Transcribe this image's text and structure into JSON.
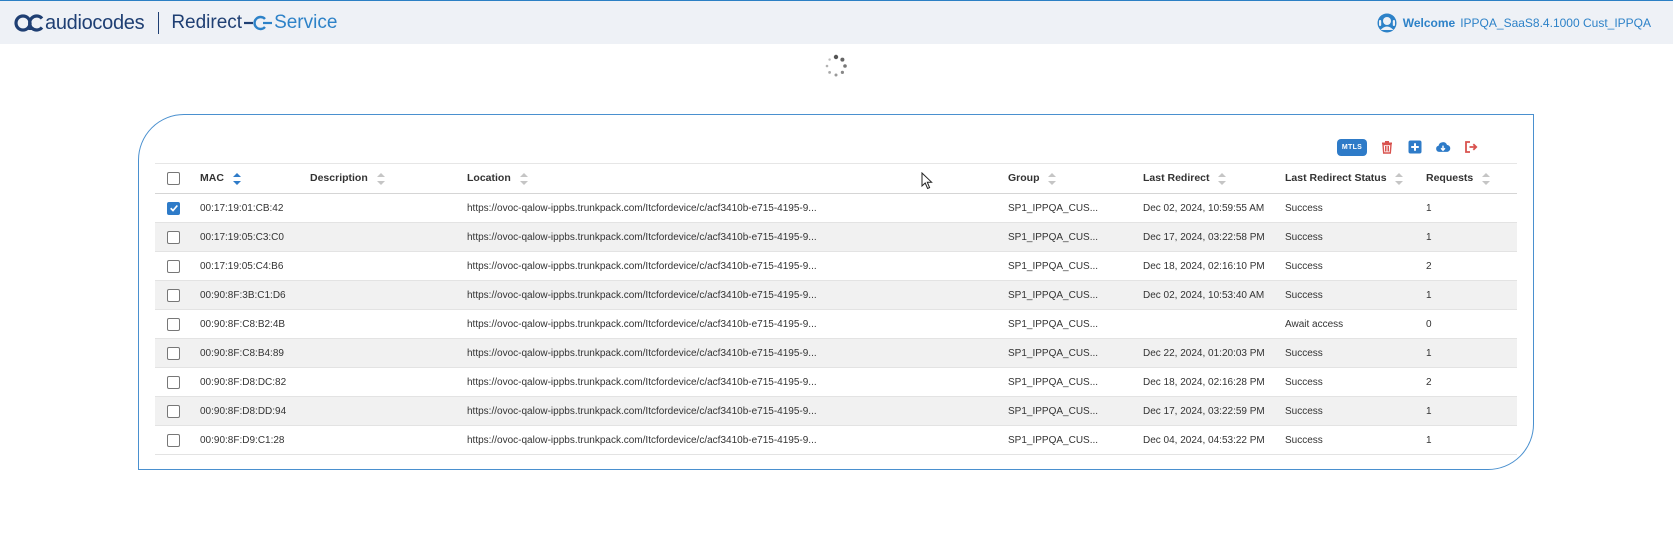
{
  "header": {
    "brand": "audiocodes",
    "service_name_part1": "Redirect",
    "service_name_part2": "Service",
    "welcome_label": "Welcome",
    "welcome_user": "IPPQA_SaaS8.4.1000 Cust_IPPQA"
  },
  "toolbar": {
    "mtls_label": "MTLS",
    "icons": [
      "trash-icon",
      "add-icon",
      "cloud-download-icon",
      "logout-icon"
    ]
  },
  "table": {
    "columns": [
      "MAC",
      "Description",
      "Location",
      "Group",
      "Last Redirect",
      "Last Redirect Status",
      "Requests"
    ],
    "sorted_column": "MAC",
    "rows": [
      {
        "checked": true,
        "mac": "00:17:19:01:CB:42",
        "description": "",
        "location": "https://ovoc-qalow-ippbs.trunkpack.com/Itcfordevice/c/acf3410b-e715-4195-9...",
        "group": "SP1_IPPQA_CUS...",
        "last_redirect": "Dec 02, 2024, 10:59:55 AM",
        "status": "Success",
        "requests": "1"
      },
      {
        "checked": false,
        "mac": "00:17:19:05:C3:C0",
        "description": "",
        "location": "https://ovoc-qalow-ippbs.trunkpack.com/Itcfordevice/c/acf3410b-e715-4195-9...",
        "group": "SP1_IPPQA_CUS...",
        "last_redirect": "Dec 17, 2024, 03:22:58 PM",
        "status": "Success",
        "requests": "1"
      },
      {
        "checked": false,
        "mac": "00:17:19:05:C4:B6",
        "description": "",
        "location": "https://ovoc-qalow-ippbs.trunkpack.com/Itcfordevice/c/acf3410b-e715-4195-9...",
        "group": "SP1_IPPQA_CUS...",
        "last_redirect": "Dec 18, 2024, 02:16:10 PM",
        "status": "Success",
        "requests": "2"
      },
      {
        "checked": false,
        "mac": "00:90:8F:3B:C1:D6",
        "description": "",
        "location": "https://ovoc-qalow-ippbs.trunkpack.com/Itcfordevice/c/acf3410b-e715-4195-9...",
        "group": "SP1_IPPQA_CUS...",
        "last_redirect": "Dec 02, 2024, 10:53:40 AM",
        "status": "Success",
        "requests": "1"
      },
      {
        "checked": false,
        "mac": "00:90:8F:C8:B2:4B",
        "description": "",
        "location": "https://ovoc-qalow-ippbs.trunkpack.com/Itcfordevice/c/acf3410b-e715-4195-9...",
        "group": "SP1_IPPQA_CUS...",
        "last_redirect": "",
        "status": "Await access",
        "requests": "0"
      },
      {
        "checked": false,
        "mac": "00:90:8F:C8:B4:89",
        "description": "",
        "location": "https://ovoc-qalow-ippbs.trunkpack.com/Itcfordevice/c/acf3410b-e715-4195-9...",
        "group": "SP1_IPPQA_CUS...",
        "last_redirect": "Dec 22, 2024, 01:20:03 PM",
        "status": "Success",
        "requests": "1"
      },
      {
        "checked": false,
        "mac": "00:90:8F:D8:DC:82",
        "description": "",
        "location": "https://ovoc-qalow-ippbs.trunkpack.com/Itcfordevice/c/acf3410b-e715-4195-9...",
        "group": "SP1_IPPQA_CUS...",
        "last_redirect": "Dec 18, 2024, 02:16:28 PM",
        "status": "Success",
        "requests": "2"
      },
      {
        "checked": false,
        "mac": "00:90:8F:D8:DD:94",
        "description": "",
        "location": "https://ovoc-qalow-ippbs.trunkpack.com/Itcfordevice/c/acf3410b-e715-4195-9...",
        "group": "SP1_IPPQA_CUS...",
        "last_redirect": "Dec 17, 2024, 03:22:59 PM",
        "status": "Success",
        "requests": "1"
      },
      {
        "checked": false,
        "mac": "00:90:8F:D9:C1:28",
        "description": "",
        "location": "https://ovoc-qalow-ippbs.trunkpack.com/Itcfordevice/c/acf3410b-e715-4195-9...",
        "group": "SP1_IPPQA_CUS...",
        "last_redirect": "Dec 04, 2024, 04:53:22 PM",
        "status": "Success",
        "requests": "1"
      }
    ]
  },
  "colors": {
    "brand_dark": "#1f3f73",
    "accent_blue": "#2e7bc8",
    "delete_red": "#d9534f",
    "header_bg": "#eef1f6"
  }
}
